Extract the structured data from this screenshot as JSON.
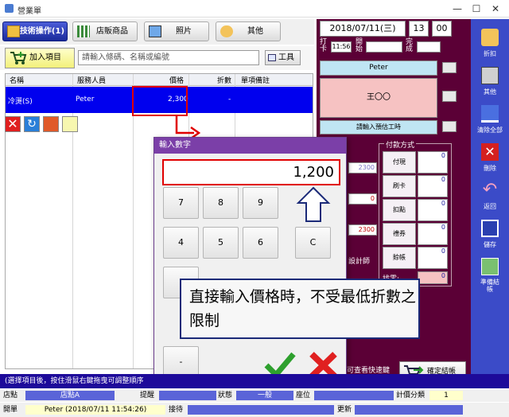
{
  "window": {
    "title": "營業單",
    "minimize": "—",
    "maximize": "☐",
    "close": "✕"
  },
  "tabs": [
    {
      "label": "技術操作(1)",
      "active": true
    },
    {
      "label": "店販商品",
      "active": false
    },
    {
      "label": "照片",
      "active": false
    },
    {
      "label": "其他",
      "active": false
    }
  ],
  "toolbar": {
    "add_item": "加入項目",
    "search_placeholder": "請輸入條碼、名稱或編號",
    "tools": "工具"
  },
  "grid": {
    "headers": [
      "名稱",
      "服務人員",
      "價格",
      "折數",
      "單項備註"
    ],
    "rows": [
      {
        "name": "冷燙(S)",
        "staff": "Peter",
        "price": "2,300",
        "discount": "-",
        "note": ""
      }
    ]
  },
  "right_panel": {
    "date": "2018/07/11(三)",
    "hour": "13",
    "minute": "00",
    "punch_label": "打卡",
    "punch_time": "11:56",
    "start_label": "開始",
    "end_label": "完成",
    "staff_name": "Peter",
    "customer_name": "王〇〇",
    "designer_prompt": "請輸入預估工時",
    "payment_title": "付款方式",
    "payments": [
      {
        "label": "付現",
        "value": "0"
      },
      {
        "label": "刷卡",
        "value": "0"
      },
      {
        "label": "扣點",
        "value": "0"
      },
      {
        "label": "禮券",
        "value": "0"
      },
      {
        "label": "賒帳",
        "value": "0"
      }
    ],
    "change_label": "找零:",
    "change_value": "0",
    "side_values": [
      "2300",
      "0",
      "2300"
    ],
    "designer_label": "設計師",
    "quick_view": "可查看快速鍵",
    "checkout": "確定結帳"
  },
  "sidebar": [
    {
      "label": "折扣",
      "icon": "discount-icon"
    },
    {
      "label": "其他",
      "icon": "other-icon"
    },
    {
      "label": "清除全部",
      "icon": "clear-all-icon"
    },
    {
      "label": "刪除",
      "icon": "delete-icon"
    },
    {
      "label": "返回",
      "icon": "back-icon"
    },
    {
      "label": "儲存",
      "icon": "save-icon"
    },
    {
      "label": "準備結帳",
      "icon": "prepare-checkout-icon"
    }
  ],
  "dialog": {
    "title": "輸入數字",
    "value": "1,200",
    "keys": [
      "7",
      "8",
      "9",
      "4",
      "5",
      "6",
      "C",
      "-"
    ]
  },
  "callout": {
    "text": "直接輸入價格時，不受最低折數之限制"
  },
  "status": {
    "hint": "(選擇項目後，按住滑鼠右鍵拖曳可調整順序",
    "store_label": "店點",
    "store_value": "店點A",
    "remind_label": "提醒",
    "state_label": "狀態",
    "state_value": "一般",
    "seat_label": "座位",
    "calc_label": "計價分類",
    "calc_value": "1",
    "open_label": "開單",
    "open_value": "Peter (2018/07/11 11:54:26)",
    "reception_label": "接待",
    "update_label": "更新"
  },
  "colors": {
    "accent": "#0000ee",
    "panel": "#5b0036",
    "sidebar": "#3b4bc8",
    "highlight": "#e00000"
  }
}
